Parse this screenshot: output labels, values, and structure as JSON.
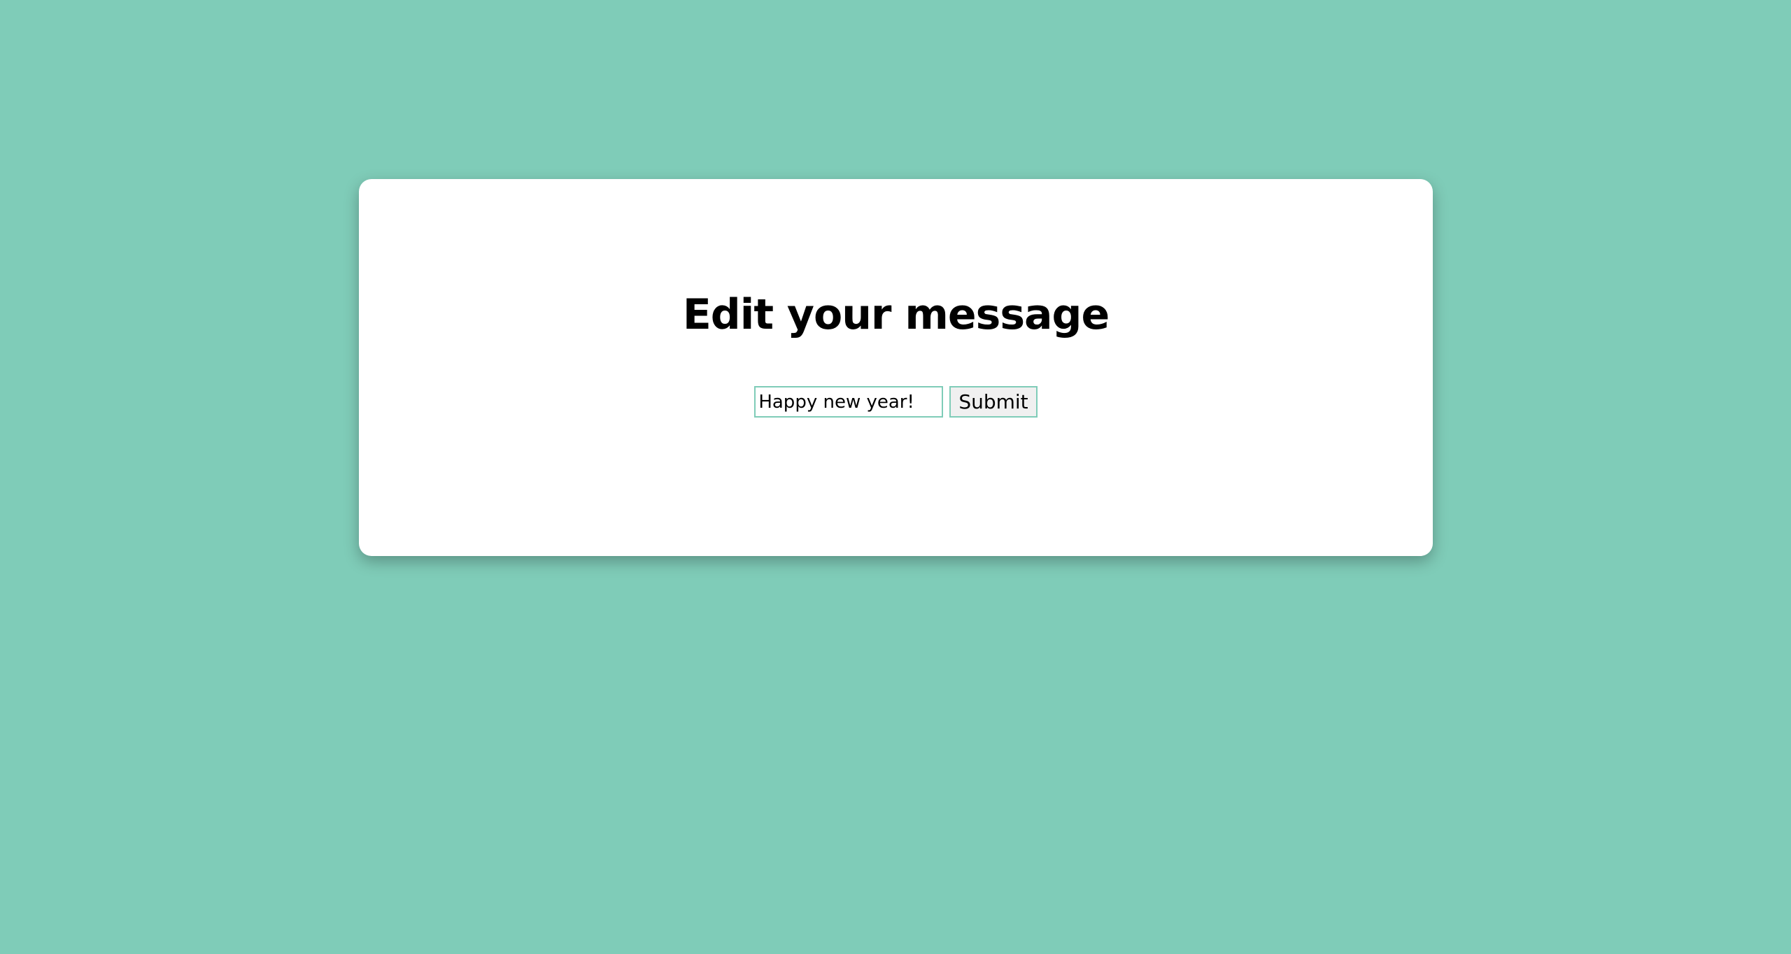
{
  "colors": {
    "background": "#7fccb8",
    "card": "#ffffff",
    "input_border": "#7fccb8",
    "button_background": "#f0f0f0"
  },
  "card": {
    "title": "Edit your message",
    "form": {
      "message_value": "Happy new year!",
      "submit_label": "Submit"
    }
  }
}
